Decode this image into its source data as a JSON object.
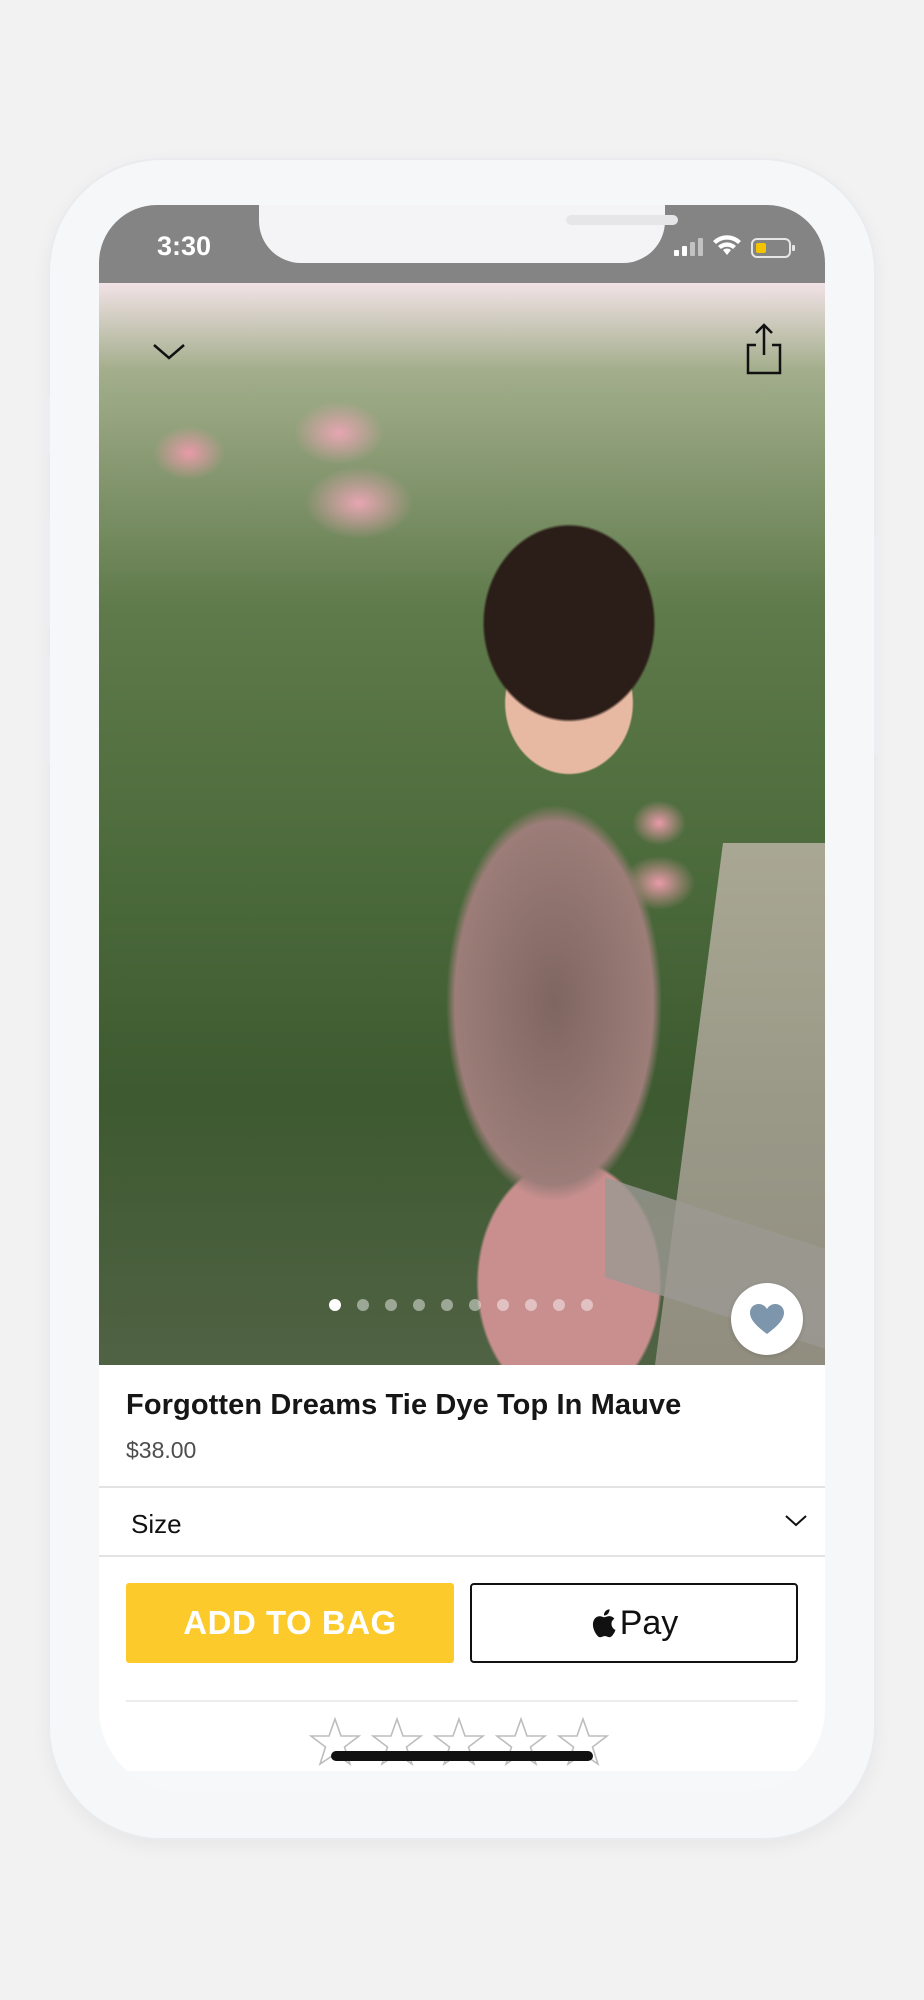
{
  "status_bar": {
    "time": "3:30"
  },
  "product": {
    "title": "Forgotten Dreams Tie Dye Top In Mauve",
    "price": "$38.00",
    "image_count": 10,
    "active_image_index": 0,
    "favorite_color": "#7d96ab"
  },
  "size_selector": {
    "label": "Size"
  },
  "actions": {
    "add_to_bag_label": "ADD TO BAG",
    "apple_pay_label": "Pay"
  },
  "rating": {
    "stars_max": 5
  },
  "icons": {
    "collapse": "chevron-down-icon",
    "share": "share-icon",
    "favorite": "heart-icon",
    "size_dropdown": "chevron-down-icon",
    "apple": "apple-icon"
  },
  "colors": {
    "accent": "#fdca2b",
    "status_bar": "#848484",
    "battery": "#f3c300"
  }
}
